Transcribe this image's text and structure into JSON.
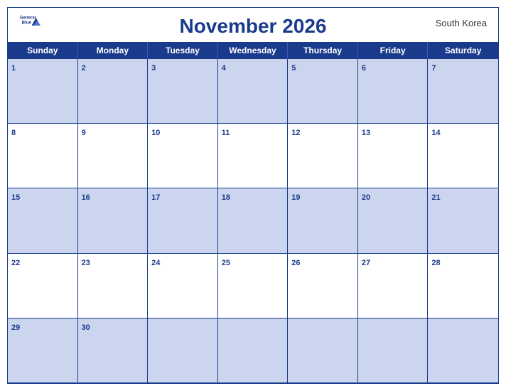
{
  "header": {
    "title": "November 2026",
    "country": "South Korea",
    "logo_general": "General",
    "logo_blue": "Blue"
  },
  "days": [
    "Sunday",
    "Monday",
    "Tuesday",
    "Wednesday",
    "Thursday",
    "Friday",
    "Saturday"
  ],
  "weeks": [
    [
      {
        "date": "1",
        "row": 1
      },
      {
        "date": "2",
        "row": 1
      },
      {
        "date": "3",
        "row": 1
      },
      {
        "date": "4",
        "row": 1
      },
      {
        "date": "5",
        "row": 1
      },
      {
        "date": "6",
        "row": 1
      },
      {
        "date": "7",
        "row": 1
      }
    ],
    [
      {
        "date": "8",
        "row": 2
      },
      {
        "date": "9",
        "row": 2
      },
      {
        "date": "10",
        "row": 2
      },
      {
        "date": "11",
        "row": 2
      },
      {
        "date": "12",
        "row": 2
      },
      {
        "date": "13",
        "row": 2
      },
      {
        "date": "14",
        "row": 2
      }
    ],
    [
      {
        "date": "15",
        "row": 3
      },
      {
        "date": "16",
        "row": 3
      },
      {
        "date": "17",
        "row": 3
      },
      {
        "date": "18",
        "row": 3
      },
      {
        "date": "19",
        "row": 3
      },
      {
        "date": "20",
        "row": 3
      },
      {
        "date": "21",
        "row": 3
      }
    ],
    [
      {
        "date": "22",
        "row": 4
      },
      {
        "date": "23",
        "row": 4
      },
      {
        "date": "24",
        "row": 4
      },
      {
        "date": "25",
        "row": 4
      },
      {
        "date": "26",
        "row": 4
      },
      {
        "date": "27",
        "row": 4
      },
      {
        "date": "28",
        "row": 4
      }
    ],
    [
      {
        "date": "29",
        "row": 5
      },
      {
        "date": "30",
        "row": 5
      },
      {
        "date": "",
        "row": 5
      },
      {
        "date": "",
        "row": 5
      },
      {
        "date": "",
        "row": 5
      },
      {
        "date": "",
        "row": 5
      },
      {
        "date": "",
        "row": 5
      }
    ]
  ],
  "colors": {
    "blue": "#1a3a8c",
    "row_odd": "#ccd5ee",
    "row_even": "#ffffff",
    "header_bg": "#1a3a8c",
    "header_text": "#ffffff"
  }
}
